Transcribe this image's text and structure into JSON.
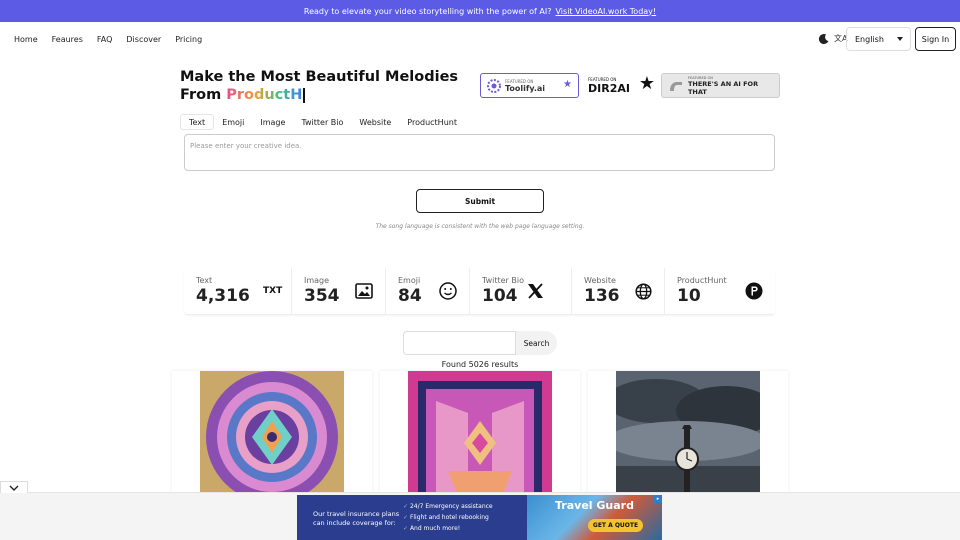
{
  "banner": {
    "text": "Ready to elevate your video storytelling with the power of AI?",
    "link": "Visit VideoAI.work Today!"
  },
  "nav": {
    "links": [
      "Home",
      "Feaures",
      "FAQ",
      "Discover",
      "Pricing"
    ],
    "language": "English",
    "signin": "Sign In"
  },
  "hero": {
    "line1": "Make the Most Beautiful Melodies",
    "line2_prefix": "From ",
    "line2_typed": "ProductH"
  },
  "badges": {
    "toolify_small": "FEATURED ON",
    "toolify_big": "Toolify.ai",
    "dir2ai_small": "FEATURED ON",
    "dir2ai_big": "DIR2AI",
    "taaft_small": "FEATURED ON",
    "taaft_big": "THERE'S AN AI FOR THAT"
  },
  "tabs": [
    "Text",
    "Emoji",
    "Image",
    "Twitter Bio",
    "Website",
    "ProductHunt"
  ],
  "input": {
    "placeholder": "Please enter your creative idea."
  },
  "submit": "Submit",
  "note": "The song language is consistent with the web page language setting.",
  "stats": [
    {
      "label": "Text",
      "value": "4,316",
      "icon": "txt-icon"
    },
    {
      "label": "Image",
      "value": "354",
      "icon": "image-icon"
    },
    {
      "label": "Emoji",
      "value": "84",
      "icon": "smiley-icon"
    },
    {
      "label": "Twitter Bio",
      "value": "104",
      "icon": "x-logo-icon"
    },
    {
      "label": "Website",
      "value": "136",
      "icon": "globe-icon"
    },
    {
      "label": "ProductHunt",
      "value": "10",
      "icon": "producthunt-icon"
    }
  ],
  "search": {
    "button": "Search"
  },
  "found": "Found 5026 results",
  "ad": {
    "text": "Our travel insurance plans can include coverage for:",
    "bullets": [
      "24/7 Emergency assistance",
      "Flight and hotel rebooking",
      "And much more!"
    ],
    "brand": "Travel Guard",
    "cta": "GET A QUOTE"
  },
  "colors": {
    "banner": "#5b5be6",
    "ad_bg": "#2a3d8f",
    "cta": "#f4c430"
  }
}
